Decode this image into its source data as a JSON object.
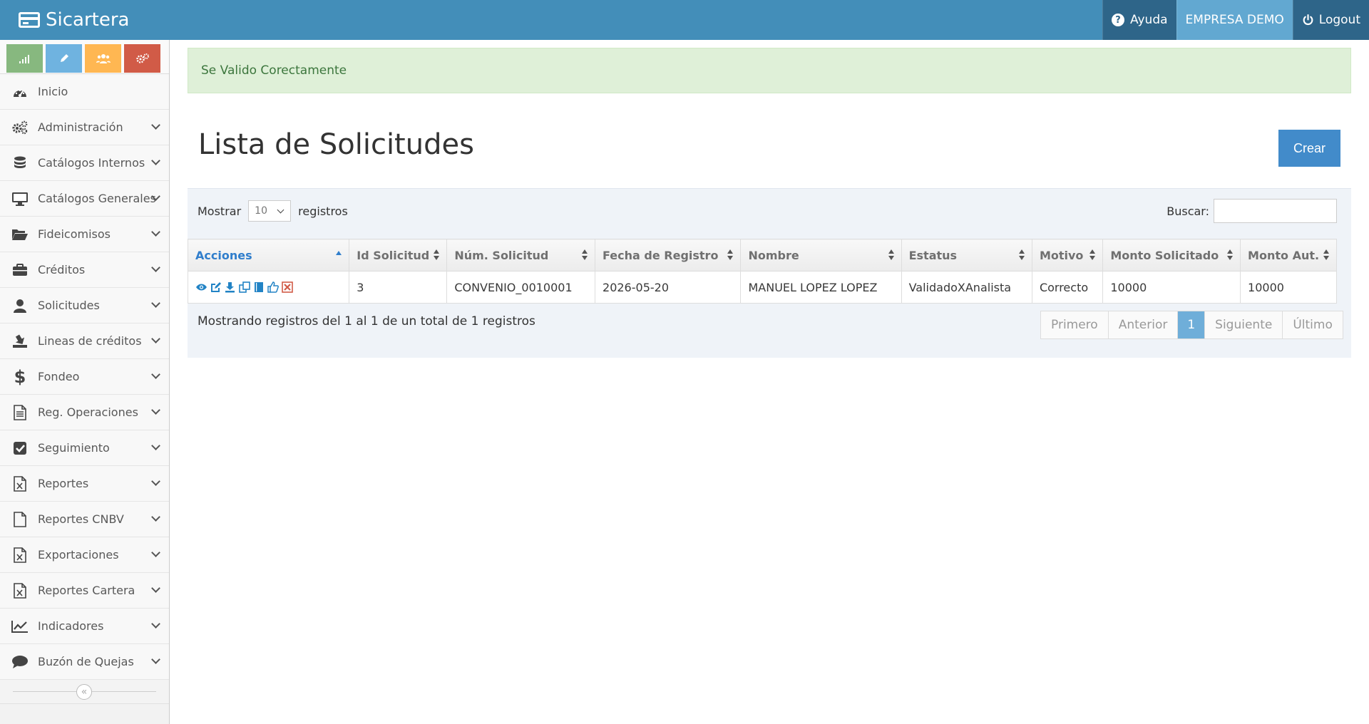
{
  "app": {
    "brand": "Sicartera"
  },
  "navbar": {
    "help": "Ayuda",
    "company": "EMPRESA DEMO",
    "logout": "Logout"
  },
  "sidebar": {
    "items": [
      {
        "label": "Inicio",
        "icon": "dashboard-icon"
      },
      {
        "label": "Administración",
        "icon": "cogs-icon"
      },
      {
        "label": "Catálogos Internos",
        "icon": "database-icon"
      },
      {
        "label": "Catálogos Generales",
        "icon": "desktop-icon"
      },
      {
        "label": "Fideicomisos",
        "icon": "folder-open-icon"
      },
      {
        "label": "Créditos",
        "icon": "briefcase-icon"
      },
      {
        "label": "Solicitudes",
        "icon": "user-icon"
      },
      {
        "label": "Lineas de créditos",
        "icon": "download-tray-icon"
      },
      {
        "label": "Fondeo",
        "icon": "dollar-icon"
      },
      {
        "label": "Reg. Operaciones",
        "icon": "file-text-icon"
      },
      {
        "label": "Seguimiento",
        "icon": "check-square-icon"
      },
      {
        "label": "Reportes",
        "icon": "file-excel-icon"
      },
      {
        "label": "Reportes CNBV",
        "icon": "file-icon"
      },
      {
        "label": "Exportaciones",
        "icon": "file-excel-icon"
      },
      {
        "label": "Reportes Cartera",
        "icon": "file-excel-icon"
      },
      {
        "label": "Indicadores",
        "icon": "line-chart-icon"
      },
      {
        "label": "Buzón de Quejas",
        "icon": "comment-icon"
      }
    ],
    "collapse_glyph": "«"
  },
  "alert": {
    "message": "Se Valido Corectamente"
  },
  "page": {
    "title": "Lista de Solicitudes",
    "create_label": "Crear"
  },
  "table": {
    "length_prefix": "Mostrar",
    "length_value": "10",
    "length_suffix": "registros",
    "search_label": "Buscar:",
    "columns": [
      "Acciones",
      "Id Solicitud",
      "Núm. Solicitud",
      "Fecha de Registro",
      "Nombre",
      "Estatus",
      "Motivo",
      "Monto Solicitado",
      "Monto Aut."
    ],
    "rows": [
      [
        "",
        "3",
        "CONVENIO_0010001",
        "2026-05-20",
        "MANUEL LOPEZ LOPEZ",
        "ValidadoXAnalista",
        "Correcto",
        "10000",
        "10000"
      ]
    ],
    "row_actions": [
      "view-icon",
      "edit-icon",
      "download-icon",
      "copy-icon",
      "book-icon",
      "thumbs-up-icon",
      "delete-icon"
    ],
    "info": "Mostrando registros del 1 al 1 de un total de 1 registros",
    "pagination": [
      "Primero",
      "Anterior",
      "1",
      "Siguiente",
      "Último"
    ]
  },
  "colors": {
    "navbar": "#438eb9",
    "accent": "#428bca",
    "success_bg": "#dff0d8",
    "success_text": "#3c763d"
  }
}
